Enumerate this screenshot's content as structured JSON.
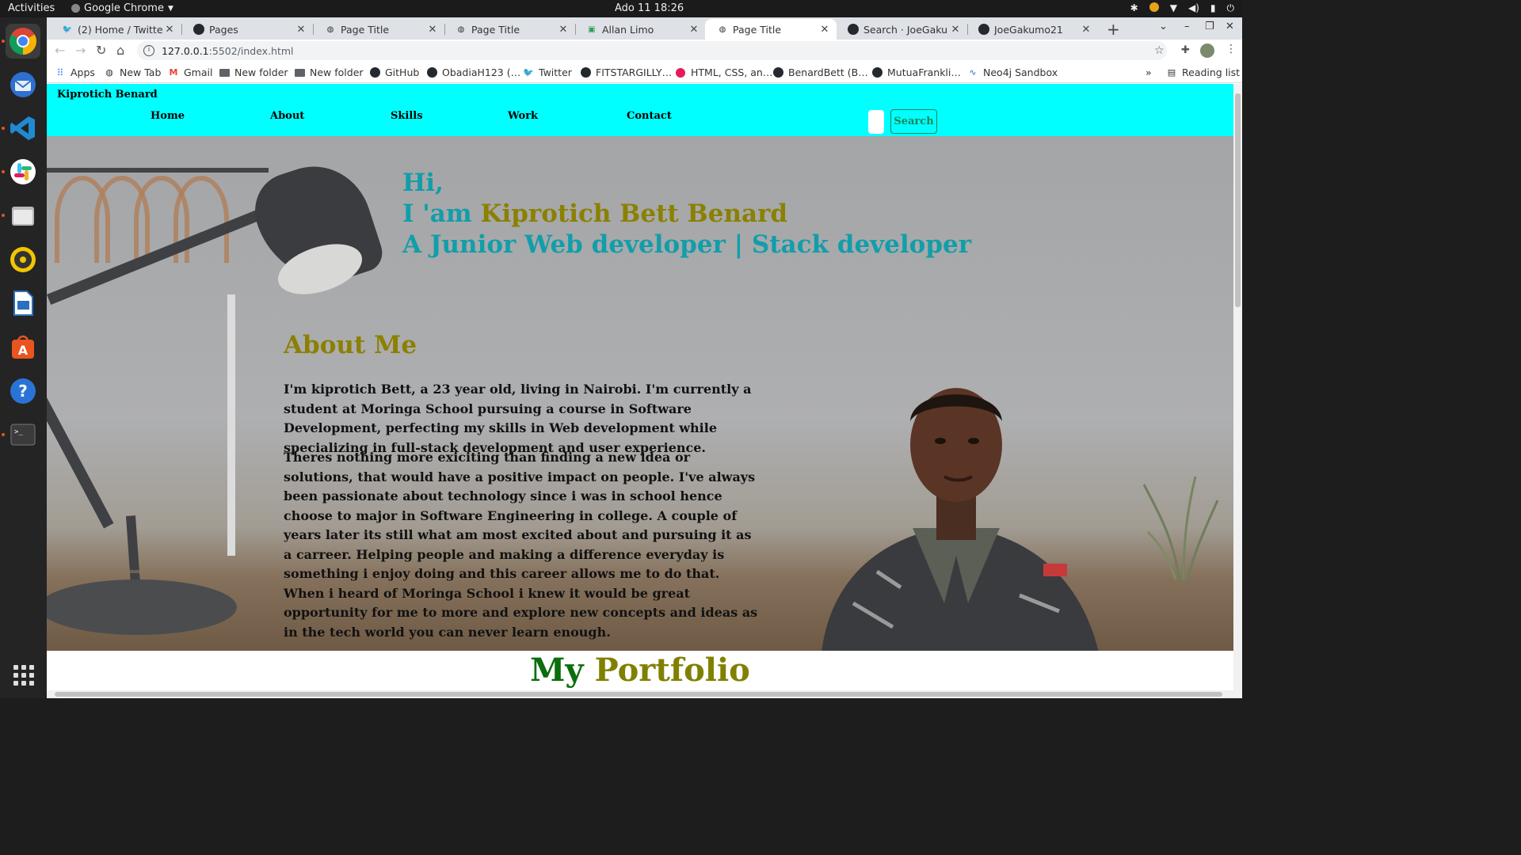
{
  "desktop": {
    "activities": "Activities",
    "app_name": "Google Chrome",
    "clock": "Ado 11  18:26"
  },
  "tabs": [
    {
      "title": "(2) Home / Twitter",
      "icon": "twitter-icon",
      "selected": false
    },
    {
      "title": "Pages",
      "icon": "github-icon",
      "selected": false
    },
    {
      "title": "Page Title",
      "icon": "globe-icon",
      "selected": false
    },
    {
      "title": "Page Title",
      "icon": "globe-icon",
      "selected": false
    },
    {
      "title": "Allan Limo",
      "icon": "page-icon",
      "selected": false
    },
    {
      "title": "Page Title",
      "icon": "globe-icon",
      "selected": true
    },
    {
      "title": "Search · JoeGakumo",
      "icon": "github-icon",
      "selected": false
    },
    {
      "title": "JoeGakumo21",
      "icon": "github-icon",
      "selected": false
    }
  ],
  "address_bar": {
    "host": "127.0.0.1",
    "path": ":5502/index.html"
  },
  "bookmarks": [
    {
      "label": "Apps",
      "icon": "apps-grid-icon"
    },
    {
      "label": "New Tab",
      "icon": "globe-icon"
    },
    {
      "label": "Gmail",
      "icon": "gmail-icon"
    },
    {
      "label": "New folder",
      "icon": "folder-icon"
    },
    {
      "label": "New folder",
      "icon": "folder-icon"
    },
    {
      "label": "GitHub",
      "icon": "github-icon"
    },
    {
      "label": "ObadiaH123 (…",
      "icon": "github-icon"
    },
    {
      "label": "Twitter",
      "icon": "twitter-icon"
    },
    {
      "label": "FITSTARGILLY…",
      "icon": "github-icon"
    },
    {
      "label": "HTML, CSS, an…",
      "icon": "pink-circle-icon"
    },
    {
      "label": "BenardBett (B…",
      "icon": "github-icon"
    },
    {
      "label": "MutuaFrankli…",
      "icon": "github-icon"
    },
    {
      "label": "Neo4j Sandbox",
      "icon": "neo4j-icon"
    }
  ],
  "reading_list": "Reading list",
  "overflow_chevron": "»",
  "site": {
    "brand": "Kiprotich Benard",
    "nav": [
      "Home",
      "About",
      "Skills",
      "Work",
      "Contact"
    ],
    "search_button": "Search",
    "greeting_hi": "Hi,",
    "greeting_prefix": "I 'am",
    "greeting_name": "Kiprotich Bett Benard",
    "greeting_role": "A Junior Web developer | Stack developer",
    "about_title": "About Me",
    "about_p1": "I'm kiprotich Bett, a 23 year old, living in Nairobi. I'm currently a student at Moringa School pursuing a course in Software Development, perfecting my skills in Web development while specializing in full-stack development and user experience.",
    "about_p2": "Theres nothing more exiciting than finding a new idea or solutions, that would have a positive impact on people. I've always been passionate about technology since i was in school hence choose to major in Software Engineering in college. A couple of years later its still what am most excited about and pursuing it as a carreer. Helping people and making a difference everyday is something i enjoy doing and this career allows me to do that. When i heard of Moringa School i knew it would be great opportunity for me to more and explore new concepts and ideas as in the tech world you can never learn enough.",
    "portfolio_word1": "My",
    "portfolio_word2": "Portfolio"
  },
  "colors": {
    "nav_bg": "#00ffff",
    "teal_text": "#119eaa",
    "olive_text": "#8b8000",
    "search_green": "#198754"
  }
}
